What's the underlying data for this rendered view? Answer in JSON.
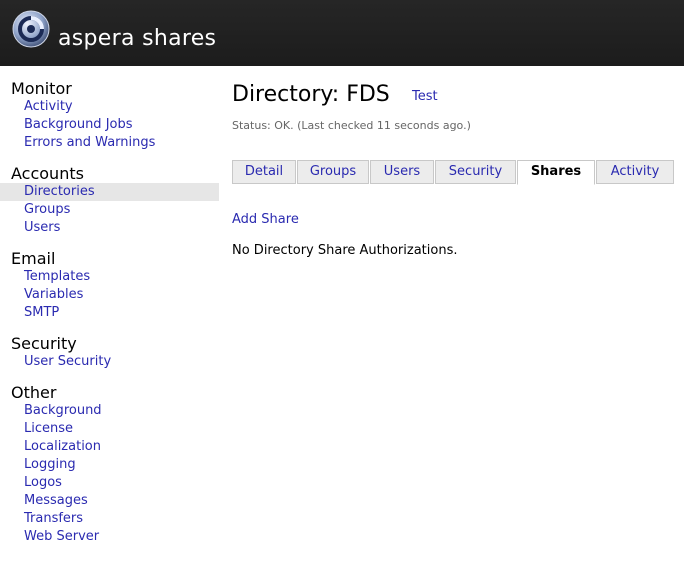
{
  "header": {
    "brand": "aspera shares",
    "logo": "aspera-logo-icon"
  },
  "sidebar": {
    "sections": [
      {
        "title": "Monitor",
        "items": [
          "Activity",
          "Background Jobs",
          "Errors and Warnings"
        ]
      },
      {
        "title": "Accounts",
        "items": [
          "Directories",
          "Groups",
          "Users"
        ],
        "active": "Directories"
      },
      {
        "title": "Email",
        "items": [
          "Templates",
          "Variables",
          "SMTP"
        ]
      },
      {
        "title": "Security",
        "items": [
          "User Security"
        ]
      },
      {
        "title": "Other",
        "items": [
          "Background",
          "License",
          "Localization",
          "Logging",
          "Logos",
          "Messages",
          "Transfers",
          "Web Server"
        ]
      }
    ]
  },
  "main": {
    "title": "Directory: FDS",
    "test_link": "Test",
    "status": "Status: OK. (Last checked 11 seconds ago.)",
    "tabs": [
      "Detail",
      "Groups",
      "Users",
      "Security",
      "Shares",
      "Activity"
    ],
    "active_tab": "Shares",
    "add_share": "Add Share",
    "empty_message": "No Directory Share Authorizations."
  },
  "colors": {
    "header_bg": "#222222",
    "link": "#2a2ab0",
    "active_row": "#e6e6e6"
  }
}
